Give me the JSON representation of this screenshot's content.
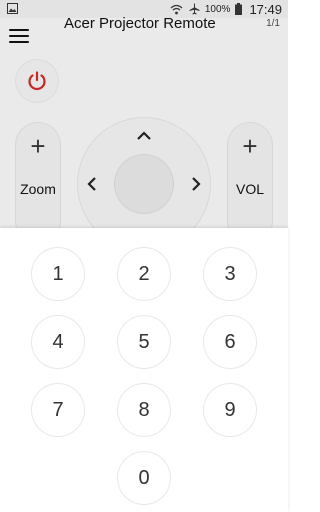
{
  "status_bar": {
    "battery_percent": "100%",
    "time": "17:49",
    "icons": [
      "gallery-icon",
      "wifi-icon",
      "airplane-mode-icon",
      "battery-icon"
    ]
  },
  "app_bar": {
    "title": "Acer Projector Remote",
    "page_indicator": "1/1",
    "menu_icon": "hamburger-menu-icon"
  },
  "remote": {
    "power_icon": "power-icon",
    "zoom": {
      "plus": "+",
      "label": "Zoom"
    },
    "volume": {
      "plus": "+",
      "label": "VOL"
    },
    "dpad_icons": [
      "chevron-up-icon",
      "chevron-left-icon",
      "chevron-right-icon"
    ]
  },
  "keypad": {
    "keys": [
      "1",
      "2",
      "3",
      "4",
      "5",
      "6",
      "7",
      "8",
      "9",
      "0"
    ]
  },
  "colors": {
    "power_accent": "#c62828",
    "dimmed_background": "#eaeaea",
    "keypad_sheet": "#ffffff"
  }
}
